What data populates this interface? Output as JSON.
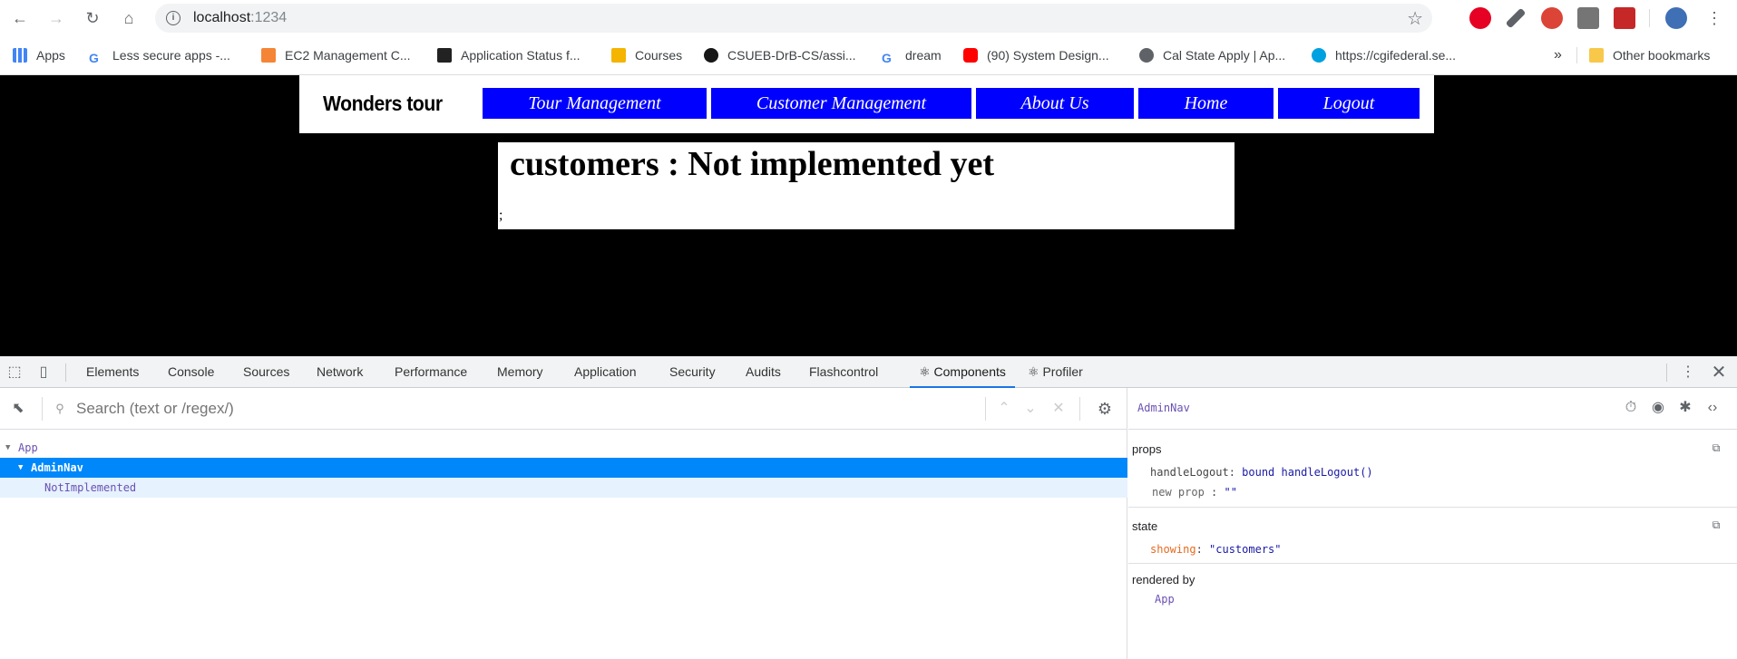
{
  "browser": {
    "url_host": "localhost",
    "url_port": ":1234",
    "bookmarks": [
      {
        "label": "Apps",
        "color": "#4285f4"
      },
      {
        "label": "Less secure apps -...",
        "color": "#4285f4"
      },
      {
        "label": "EC2 Management C...",
        "color": "#f58536"
      },
      {
        "label": "Application Status f...",
        "color": "#222222"
      },
      {
        "label": "Courses",
        "color": "#f4b400"
      },
      {
        "label": "CSUEB-DrB-CS/assi...",
        "color": "#181717"
      },
      {
        "label": "dream",
        "color": "#4285f4"
      },
      {
        "label": "(90) System Design...",
        "color": "#ff0000"
      },
      {
        "label": "Cal State Apply | Ap...",
        "color": "#5f6368"
      },
      {
        "label": "https://cgifederal.se...",
        "color": "#00a1e0"
      }
    ],
    "overflow": "»",
    "other_bookmarks": "Other bookmarks"
  },
  "app": {
    "brand": "Wonders tour",
    "nav": [
      "Tour Management",
      "Customer Management",
      "About Us",
      "Home",
      "Logout"
    ],
    "heading": "customers : Not implemented yet",
    "trailing": ";"
  },
  "devtools": {
    "tabs": [
      "Elements",
      "Console",
      "Sources",
      "Network",
      "Performance",
      "Memory",
      "Application",
      "Security",
      "Audits",
      "Flashcontrol",
      "⚛ Components",
      "⚛ Profiler"
    ],
    "search_placeholder": "Search (text or /regex/)",
    "tree": [
      {
        "label": "App",
        "depth": 0,
        "state": "normal"
      },
      {
        "label": "AdminNav",
        "depth": 1,
        "state": "selected"
      },
      {
        "label": "NotImplemented",
        "depth": 2,
        "state": "hover"
      }
    ],
    "inspector": {
      "component": "AdminNav",
      "props_title": "props",
      "props": [
        {
          "key": "handleLogout",
          "value": "bound handleLogout()"
        },
        {
          "key": "new prop",
          "value": "\"\""
        }
      ],
      "state_title": "state",
      "state": [
        {
          "key": "showing",
          "value": "\"customers\""
        }
      ],
      "rendered_by_title": "rendered by",
      "rendered_by": "App"
    }
  },
  "colors": {
    "nav_blue": "#0000ff",
    "selection_blue": "#0088fa",
    "component_purple": "#6a51b2"
  }
}
